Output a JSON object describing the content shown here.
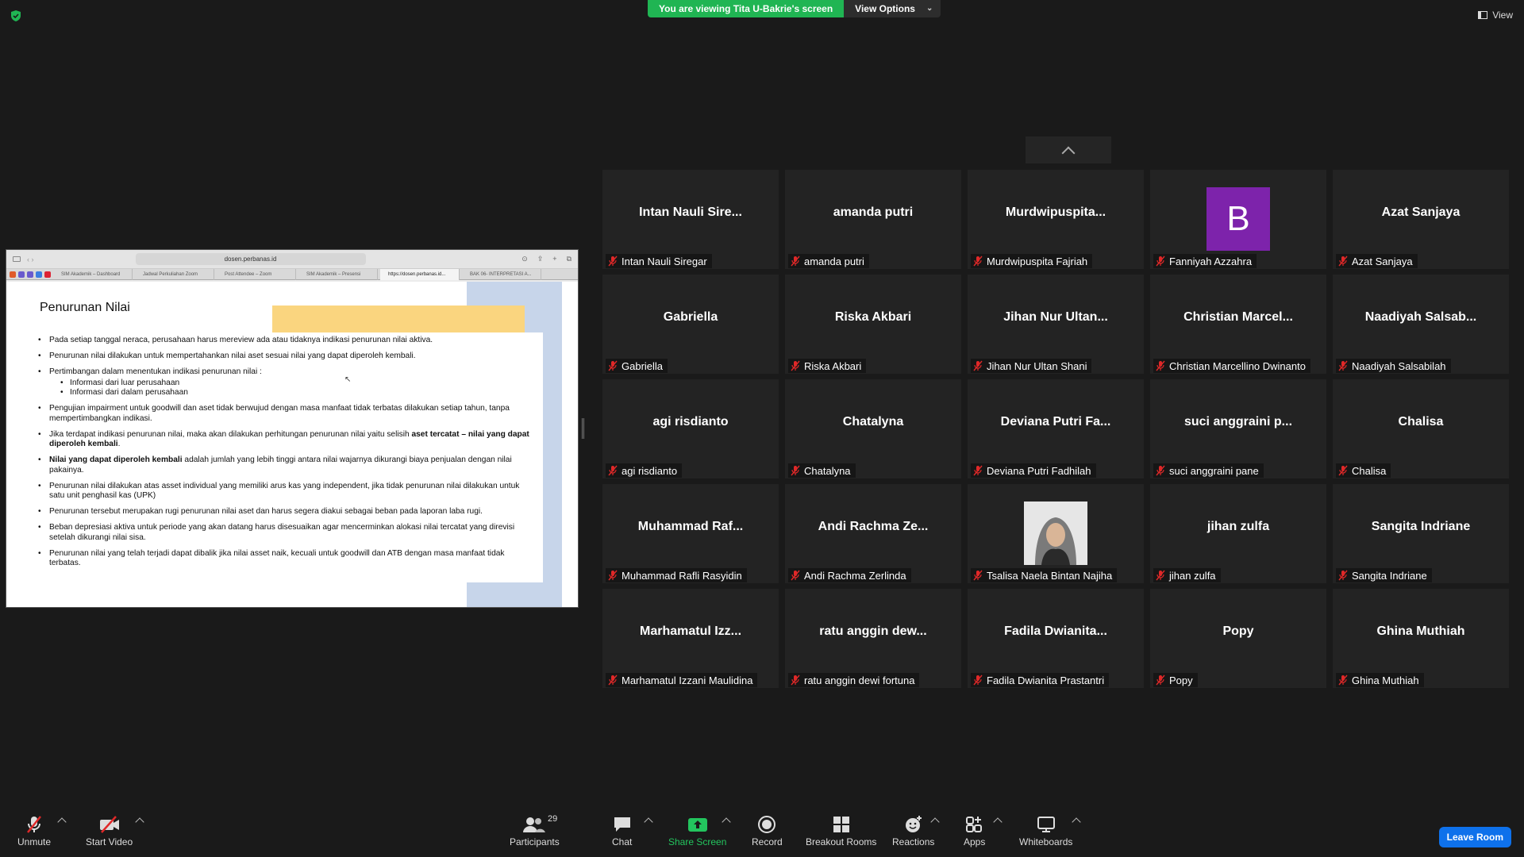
{
  "banner": {
    "viewing": "You are viewing Tita U-Bakrie's screen",
    "view_options": "View Options"
  },
  "view_label": "View",
  "browser": {
    "url": "dosen.perbanas.id",
    "tabs": [
      "SIM Akademik – Dashboard",
      "Jadwal Perkuliahan Zoom",
      "Post Attendee – Zoom",
      "SIM Akademik – Presensi",
      "https://dosen.perbanas.id...",
      "BAK 06- INTERPRETASI A..."
    ]
  },
  "slide": {
    "title": "Penurunan Nilai",
    "p1": "Pada setiap tanggal neraca, perusahaan harus mereview ada atau tidaknya indikasi penurunan nilai aktiva.",
    "p2": "Penurunan nilai dilakukan untuk mempertahankan nilai aset sesuai nilai yang dapat diperoleh kembali.",
    "p3": "Pertimbangan dalam menentukan indikasi penurunan nilai :",
    "p3a": "Informasi dari luar perusahaan",
    "p3b": "Informasi dari dalam perusahaan",
    "p4": "Pengujian impairment untuk goodwill dan aset tidak berwujud dengan masa manfaat tidak terbatas dilakukan setiap tahun, tanpa mempertimbangkan indikasi.",
    "p5_pre": "Jika terdapat indikasi penurunan nilai, maka akan dilakukan perhitungan penurunan nilai yaitu selisih ",
    "p5_bold": "aset tercatat – nilai yang dapat diperoleh kembali",
    "p5_post": ".",
    "p6_bold": "Nilai yang dapat diperoleh kembali",
    "p6_post": " adalah jumlah yang lebih tinggi antara nilai wajarnya dikurangi biaya penjualan dengan nilai pakainya.",
    "p7": "Penurunan nilai dilakukan atas asset individual yang memiliki arus kas yang independent, jika tidak penurunan nilai dilakukan untuk satu unit penghasil kas (UPK)",
    "p8": "Penurunan tersebut merupakan rugi penurunan nilai aset dan harus segera diakui sebagai beban pada laporan laba rugi.",
    "p9": "Beban depresiasi aktiva untuk periode yang akan datang harus disesuaikan agar mencerminkan alokasi nilai tercatat yang direvisi setelah dikurangi nilai sisa.",
    "p10": "Penurunan nilai yang telah terjadi dapat dibalik jika nilai asset naik, kecuali untuk goodwill dan ATB dengan masa manfaat tidak terbatas."
  },
  "participants_tiles": [
    {
      "display": "Intan Nauli Sire...",
      "name": "Intan Nauli Siregar"
    },
    {
      "display": "amanda putri",
      "name": "amanda putri"
    },
    {
      "display": "Murdwipuspita...",
      "name": "Murdwipuspita Fajriah"
    },
    {
      "display": "",
      "name": "Fanniyah Azzahra",
      "avatar_letter": "B"
    },
    {
      "display": "Azat Sanjaya",
      "name": "Azat Sanjaya"
    },
    {
      "display": "Gabriella",
      "name": "Gabriella"
    },
    {
      "display": "Riska Akbari",
      "name": "Riska Akbari"
    },
    {
      "display": "Jihan Nur Ultan...",
      "name": "Jihan Nur Ultan Shani"
    },
    {
      "display": "Christian  Marcel...",
      "name": "Christian Marcellino Dwinanto"
    },
    {
      "display": "Naadiyah  Salsab...",
      "name": "Naadiyah Salsabilah"
    },
    {
      "display": "agi risdianto",
      "name": "agi risdianto"
    },
    {
      "display": "Chatalyna",
      "name": "Chatalyna"
    },
    {
      "display": "Deviana Putri Fa...",
      "name": "Deviana Putri Fadhilah"
    },
    {
      "display": "suci anggraini p...",
      "name": "suci anggraini pane"
    },
    {
      "display": "Chalisa",
      "name": "Chalisa"
    },
    {
      "display": "Muhammad  Raf...",
      "name": "Muhammad Rafli Rasyidin"
    },
    {
      "display": "Andi Rachma Ze...",
      "name": "Andi Rachma Zerlinda"
    },
    {
      "display": "",
      "name": "Tsalisa Naela Bintan Najiha",
      "photo": true
    },
    {
      "display": "jihan zulfa",
      "name": "jihan zulfa"
    },
    {
      "display": "Sangita Indriane",
      "name": "Sangita Indriane"
    },
    {
      "display": "Marhamatul  Izz...",
      "name": "Marhamatul Izzani Maulidina"
    },
    {
      "display": "ratu  anggin  dew...",
      "name": "ratu anggin dewi fortuna"
    },
    {
      "display": "Fadila  Dwianita...",
      "name": "Fadila Dwianita Prastantri"
    },
    {
      "display": "Popy",
      "name": "Popy"
    },
    {
      "display": "Ghina Muthiah",
      "name": "Ghina Muthiah"
    }
  ],
  "toolbar": {
    "unmute": "Unmute",
    "start_video": "Start Video",
    "participants": "Participants",
    "participants_count": "29",
    "chat": "Chat",
    "share_screen": "Share Screen",
    "record": "Record",
    "breakout": "Breakout Rooms",
    "reactions": "Reactions",
    "apps": "Apps",
    "whiteboards": "Whiteboards",
    "leave": "Leave Room"
  },
  "colors": {
    "accent_green": "#20b553",
    "leave_blue": "#0e71eb",
    "avatar_purple": "#7d23ab",
    "mic_red": "#e02828"
  }
}
